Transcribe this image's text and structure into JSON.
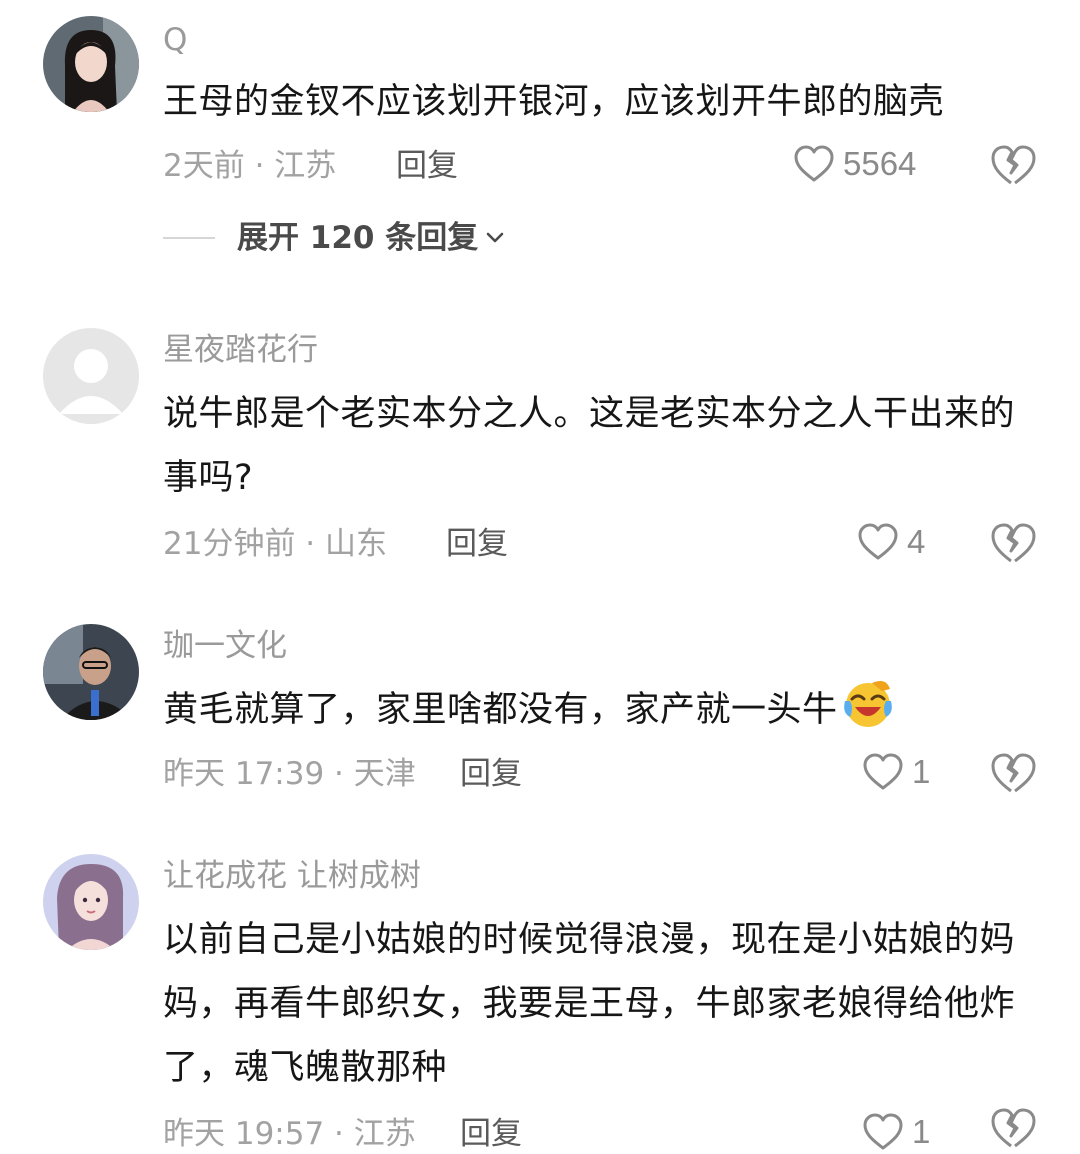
{
  "comments": [
    {
      "username": "Q",
      "content": "王母的金钗不应该划开银河，应该划开牛郎的脑壳",
      "meta": "2天前 · 江苏",
      "reply_label": "回复",
      "likes": "5564",
      "expand_label": "展开 120 条回复"
    },
    {
      "username": "星夜踏花行",
      "content": "说牛郎是个老实本分之人。这是老实本分之人干出来的事吗?",
      "meta": "21分钟前 · 山东",
      "reply_label": "回复",
      "likes": "4"
    },
    {
      "username": "珈一文化",
      "content": "黄毛就算了，家里啥都没有，家产就一头牛",
      "meta": "昨天 17:39 · 天津",
      "reply_label": "回复",
      "likes": "1"
    },
    {
      "username": "让花成花  让树成树",
      "content": "以前自己是小姑娘的时候觉得浪漫，现在是小姑娘的妈妈，再看牛郎织女，我要是王母，牛郎家老娘得给他炸了，魂飞魄散那种",
      "meta": "昨天 19:57 · 江苏",
      "reply_label": "回复",
      "likes": "1"
    }
  ],
  "icons": {
    "like": "heart-outline-icon",
    "dislike": "broken-heart-icon",
    "expand": "chevron-down-icon",
    "emoji": "laughing-crying-emoji-icon"
  },
  "colors": {
    "username": "#9a9a9a",
    "content": "#161616",
    "meta": "#a2a2a2",
    "reply": "#5a5a5a",
    "icon": "#8a8a8a"
  }
}
